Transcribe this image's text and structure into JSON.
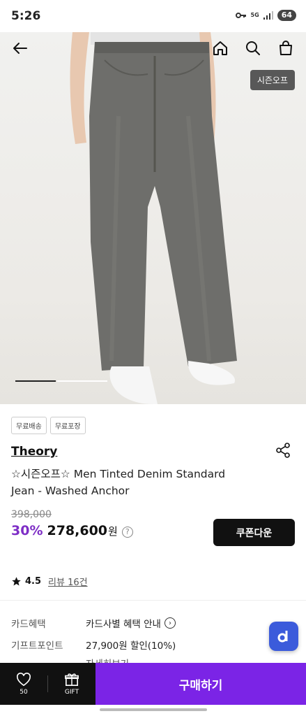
{
  "status_bar": {
    "time": "5:26",
    "network": "5G",
    "battery": "64"
  },
  "hero": {
    "season_badge": "시즌오프"
  },
  "chips": [
    "무료배송",
    "무료포장"
  ],
  "product": {
    "brand": "Theory",
    "title": "☆시즌오프☆ Men Tinted Denim Standard Jean - Washed Anchor",
    "original_price": "398,000",
    "discount": "30%",
    "price": "278,600",
    "currency": "원",
    "help": "?",
    "coupon_label": "쿠폰다운"
  },
  "rating": {
    "value": "4.5",
    "reviews": "리뷰 16건"
  },
  "benefits": {
    "card_label": "카드혜택",
    "card_value": "카드사별 혜택 안내",
    "gift_label": "기프트포인트",
    "gift_value": "27,900원 할인(10%)",
    "detail_link": "자세히보기"
  },
  "bottom_bar": {
    "wish_count": "50",
    "gift_label": "GIFT",
    "buy_label": "구매하기"
  },
  "colors": {
    "accent": "#7b24e6",
    "discount": "#7e2ec6",
    "float": "#3b5bdb"
  }
}
